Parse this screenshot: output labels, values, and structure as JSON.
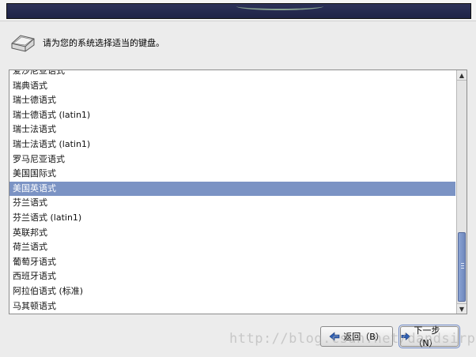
{
  "prompt": {
    "text": "请为您的系统选择适当的键盘。"
  },
  "keyboard_list": {
    "items": [
      "爱沙尼亚语式",
      "瑞典语式",
      "瑞士德语式",
      "瑞士德语式 (latin1)",
      "瑞士法语式",
      "瑞士法语式 (latin1)",
      "罗马尼亚语式",
      "美国国际式",
      "美国英语式",
      "芬兰语式",
      "芬兰语式 (latin1)",
      "英联邦式",
      "荷兰语式",
      "葡萄牙语式",
      "西班牙语式",
      "阿拉伯语式 (标准)",
      "马其顿语式"
    ],
    "selected": "美国英语式"
  },
  "buttons": {
    "back_label": "返回（B）",
    "next_label": "下一步（N）"
  },
  "watermark": {
    "text": "http://blog.csdn.net/dandsirpp"
  },
  "colors": {
    "header": "#1f2447",
    "selection": "#7b93c4",
    "scroll_thumb": "#6f88bd",
    "arrow_icon": "#2f5fb3"
  },
  "icons": [
    "keyboard-icon",
    "arrow-left-icon",
    "arrow-right-icon"
  ]
}
